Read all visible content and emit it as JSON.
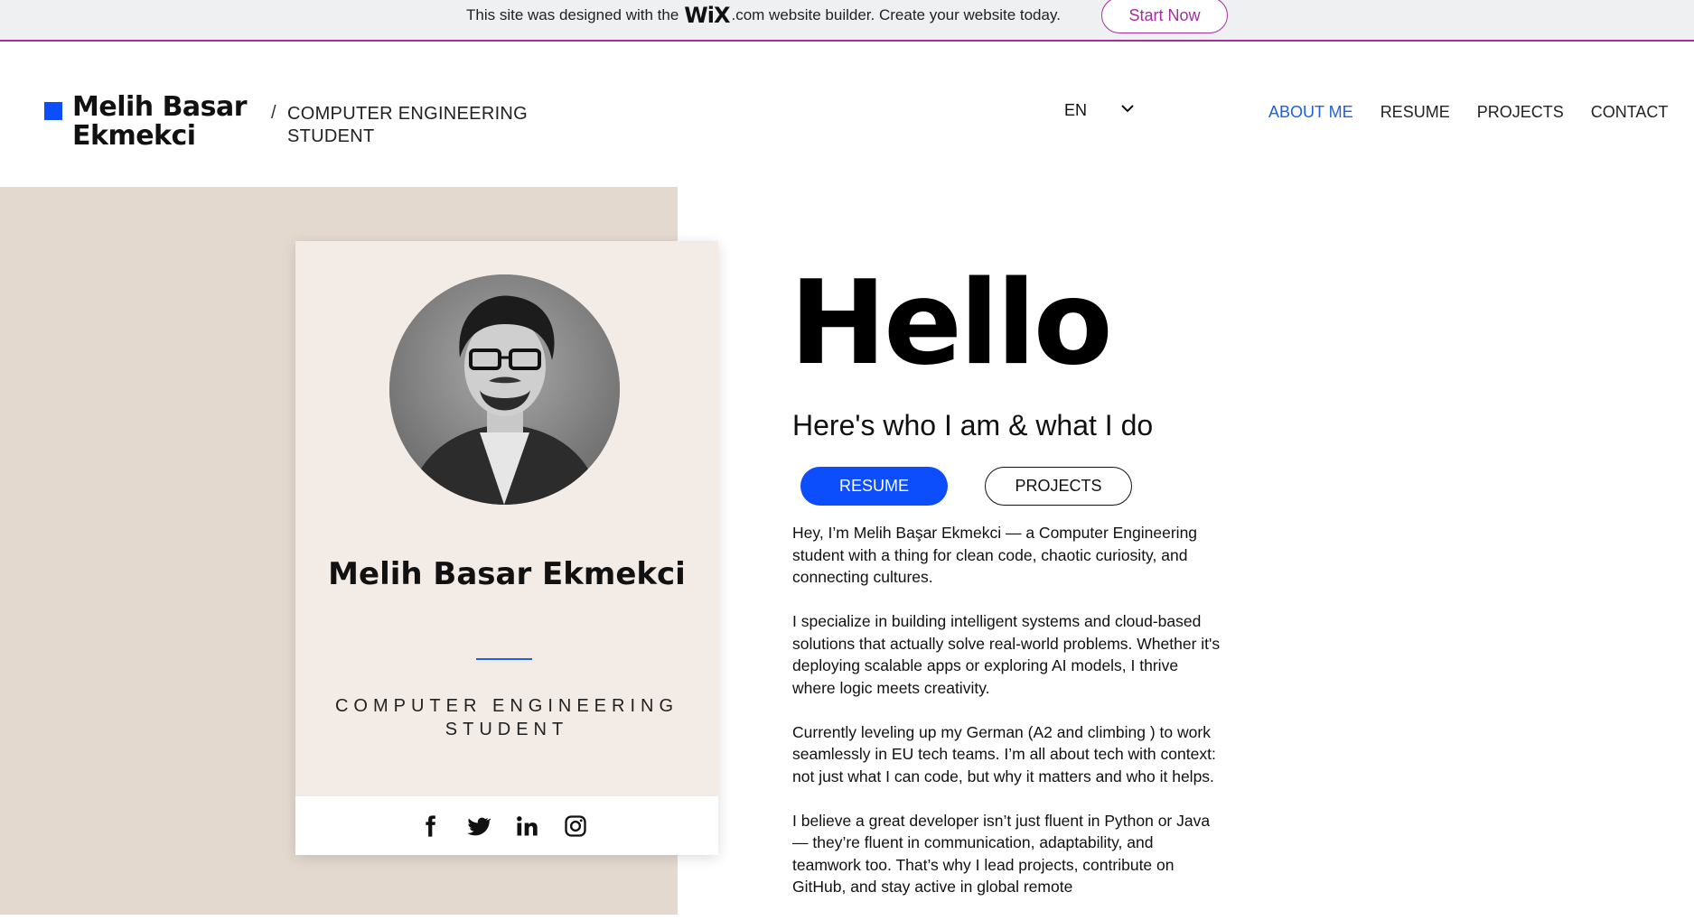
{
  "wix_banner": {
    "text_before": "This site was designed with the",
    "logo": "WiX",
    "text_after": ".com website builder. Create your website today.",
    "button_label": "Start Now",
    "accent_color": "#a42e9c"
  },
  "header": {
    "site_name": "Melih Basar Ekmekci",
    "tagline_slash": "/",
    "tagline": "COMPUTER ENGINEERING STUDENT",
    "language": {
      "selected": "EN",
      "icon": "chevron-down-icon"
    },
    "nav": [
      {
        "label": "ABOUT ME",
        "active": true
      },
      {
        "label": "RESUME",
        "active": false
      },
      {
        "label": "PROJECTS",
        "active": false
      },
      {
        "label": "CONTACT",
        "active": false
      }
    ]
  },
  "profile_card": {
    "name": "Melih Basar Ekmekci",
    "title": "COMPUTER ENGINEERING STUDENT",
    "avatar_icon": "profile-photo",
    "social_icons": [
      "facebook-icon",
      "twitter-icon",
      "linkedin-icon",
      "instagram-icon"
    ]
  },
  "main": {
    "greeting": "Hello",
    "subheading": "Here's who I am & what I do",
    "resume_button": "RESUME",
    "projects_button": "PROJECTS",
    "bio": [
      "Hey, I’m Melih Başar Ekmekci — a Computer Engineering student with a thing for clean code, chaotic curiosity, and connecting cultures.",
      "I specialize in building intelligent systems and cloud-based solutions that actually solve real-world problems. Whether it's deploying scalable apps or exploring AI models, I thrive where logic meets creativity.",
      "Currently leveling up my German (A2 and climbing ) to work seamlessly in EU tech teams. I’m all about tech with context: not just what I can code, but why it matters and who it helps.",
      "I believe a great developer isn’t just fluent in Python or Java — they’re fluent in communication, adaptability, and teamwork too. That’s why I lead projects, contribute on GitHub, and stay active in global remote"
    ]
  },
  "colors": {
    "accent_blue": "#0c4efc",
    "nav_active": "#1f5fe0",
    "beige_panel": "#e3d9cf",
    "card_bg": "#f3ebe5"
  }
}
